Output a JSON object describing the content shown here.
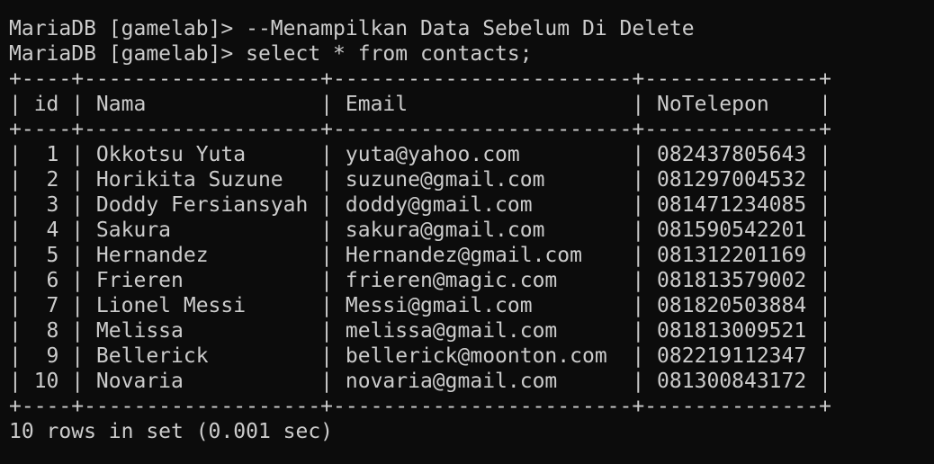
{
  "terminal": {
    "lines": [
      "MariaDB [gamelab]> --Menampilkan Data Sebelum Di Delete",
      "MariaDB [gamelab]> select * from contacts;",
      "+----+-------------------+------------------------+--------------+",
      "| id | Nama              | Email                  | NoTelepon    |",
      "+----+-------------------+------------------------+--------------+",
      "|  1 | Okkotsu Yuta      | yuta@yahoo.com         | 082437805643 |",
      "|  2 | Horikita Suzune   | suzune@gmail.com       | 081297004532 |",
      "|  3 | Doddy Fersiansyah | doddy@gmail.com        | 081471234085 |",
      "|  4 | Sakura            | sakura@gmail.com       | 081590542201 |",
      "|  5 | Hernandez         | Hernandez@gmail.com    | 081312201169 |",
      "|  6 | Frieren           | frieren@magic.com      | 081813579002 |",
      "|  7 | Lionel Messi      | Messi@gmail.com        | 081820503884 |",
      "|  8 | Melissa           | melissa@gmail.com      | 081813009521 |",
      "|  9 | Bellerick         | bellerick@moonton.com  | 082219112347 |",
      "| 10 | Novaria           | novaria@gmail.com      | 081300843172 |",
      "+----+-------------------+------------------------+--------------+",
      "10 rows in set (0.001 sec)"
    ],
    "colors": {
      "background": "#0c0c0c",
      "text": "#cccccc"
    }
  }
}
